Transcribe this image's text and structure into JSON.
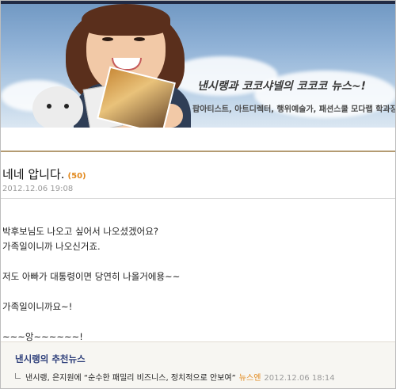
{
  "banner": {
    "title": "낸시랭과 코코샤넬의 코코코 뉴스~!",
    "subtitle": "팝아티스트, 아트디렉터, 행위예술가, 패션스쿨 모다랩 학과장"
  },
  "post": {
    "title": "네네 압니다.",
    "count": "(50)",
    "date": "2012.12.06 19:08",
    "lines": [
      "박후보님도 나오고 싶어서 나오셨겠어요?",
      "가족일이니까 나오신거죠.",
      "",
      "저도 아빠가 대통령이면 당연히 나올거에용~~",
      "",
      "가족일이니까요~!",
      "",
      "~~~앙~~~~~~!"
    ]
  },
  "recommended": {
    "heading": "낸시랭의 추천뉴스",
    "item": {
      "text": "낸시랭, 은지원에 “순수한 패밀리 비즈니스, 정치적으로 안보여”",
      "source": "뉴스엔",
      "date": "2012.12.06 18:14"
    }
  }
}
